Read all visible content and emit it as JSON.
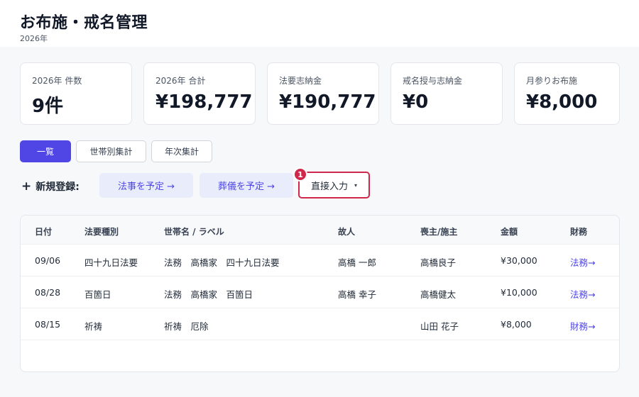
{
  "header": {
    "title": "お布施・戒名管理",
    "subtitle": "2026年"
  },
  "stats": [
    {
      "label": "2026年 件数",
      "value": "9件"
    },
    {
      "label": "2026年 合計",
      "value": "¥198,777"
    },
    {
      "label": "法要志納金",
      "value": "¥190,777"
    },
    {
      "label": "戒名授与志納金",
      "value": "¥0"
    },
    {
      "label": "月参りお布施",
      "value": "¥8,000"
    }
  ],
  "tabs": [
    {
      "label": "一覧",
      "active": true
    },
    {
      "label": "世帯別集計",
      "active": false
    },
    {
      "label": "年次集計",
      "active": false
    }
  ],
  "register": {
    "plus_icon": "+",
    "label": "新規登録:",
    "houji_button": "法事を予定 →",
    "sougi_button": "葬儀を予定 →",
    "direct_button": "直接入力",
    "direct_caret": "▾",
    "badge": "1",
    "highlight_color": "#d0284b"
  },
  "table": {
    "headers": [
      "日付",
      "法要種別",
      "世帯名 / ラベル",
      "故人",
      "喪主/施主",
      "金額",
      "財務"
    ],
    "rows": [
      {
        "date": "09/06",
        "type": "四十九日法要",
        "household": "法務　高橋家　四十九日法要",
        "deceased": "高橋 一郎",
        "chief": "高橋良子",
        "amount": "¥30,000",
        "finance": "法務→"
      },
      {
        "date": "08/28",
        "type": "百箇日",
        "household": "法務　高橋家　百箇日",
        "deceased": "高橋 幸子",
        "chief": "高橋健太",
        "amount": "¥10,000",
        "finance": "法務→"
      },
      {
        "date": "08/15",
        "type": "祈祷",
        "household": "祈祷　厄除",
        "deceased": "",
        "chief": "山田 花子",
        "amount": "¥8,000",
        "finance": "財務→"
      }
    ]
  },
  "colors": {
    "accent": "#4f46e5",
    "accent_soft": "#e9ecfb",
    "highlight": "#d0284b"
  }
}
